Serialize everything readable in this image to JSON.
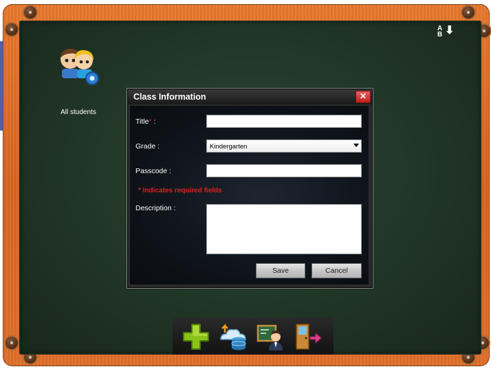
{
  "board": {
    "sort_icon": "sort-alpha-down-icon",
    "students_icon": "students-group-icon",
    "students_label": "All students"
  },
  "dialog": {
    "title": "Class Information",
    "close_symbol": "✕",
    "fields": {
      "title_label": "Title",
      "title_req_marker": "*",
      "title_suffix": " :",
      "title_value": "",
      "grade_label": "Grade :",
      "grade_value": "Kindergarten",
      "passcode_label": "Passcode :",
      "passcode_value": "",
      "required_note": "* Indicates required fields",
      "description_label": "Description :",
      "description_value": ""
    },
    "buttons": {
      "save": "Save",
      "cancel": "Cancel"
    }
  },
  "toolbar": {
    "items": [
      "add-icon",
      "upload-database-icon",
      "teacher-board-icon",
      "exit-door-icon"
    ]
  },
  "colors": {
    "frame": "#e0702a",
    "board": "#243a29",
    "required": "#e02020"
  }
}
